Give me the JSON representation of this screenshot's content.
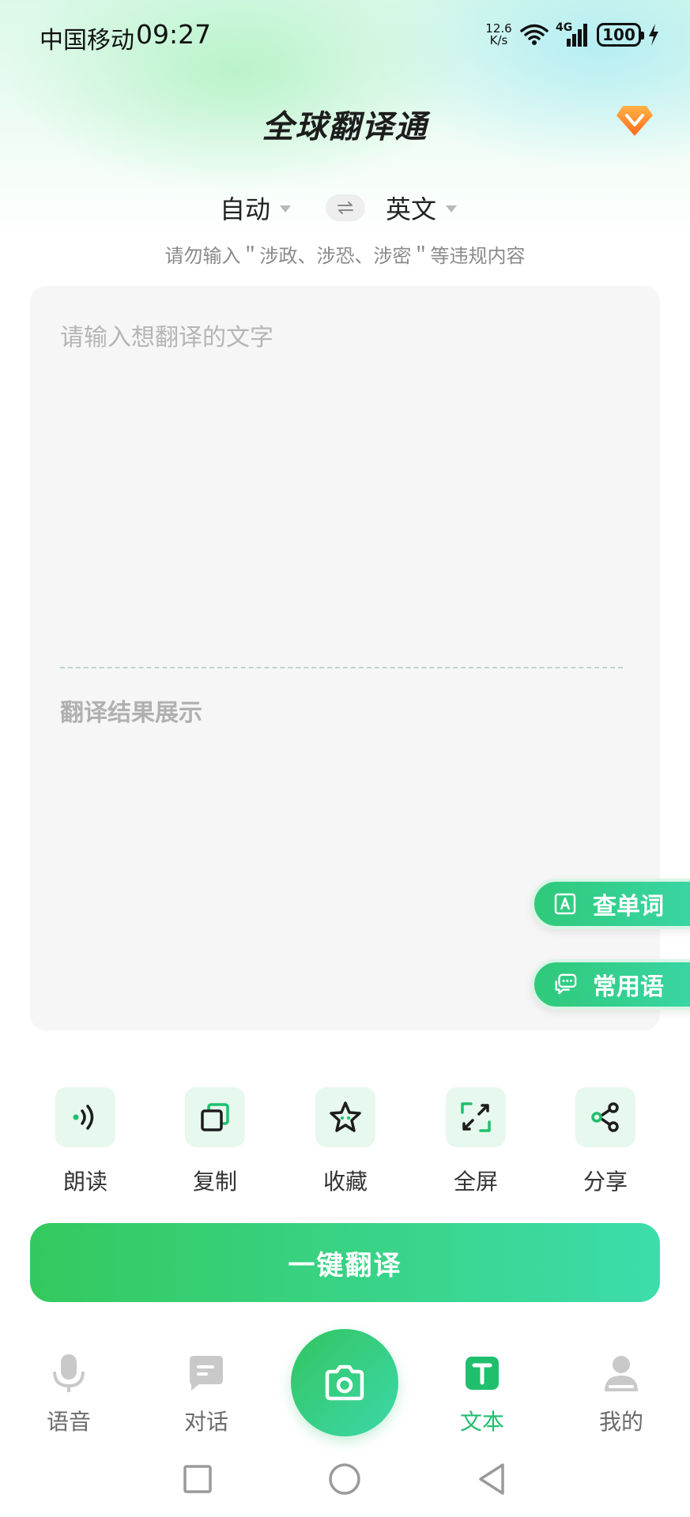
{
  "status_bar": {
    "carrier": "中国移动",
    "time": "09:27",
    "net_speed_value": "12.6",
    "net_speed_unit": "K/s",
    "network_type": "4G",
    "battery": "100"
  },
  "header": {
    "title": "全球翻译通",
    "vip_icon": "vip-diamond-icon"
  },
  "languages": {
    "source": "自动",
    "target": "英文",
    "swap_icon": "swap-arrows-icon"
  },
  "notice": "请勿输入＂涉政、涉恐、涉密＂等违规内容",
  "editor": {
    "input_placeholder": "请输入想翻译的文字",
    "result_placeholder": "翻译结果展示"
  },
  "floating_buttons": {
    "lookup_word": "查单词",
    "common_phrases": "常用语"
  },
  "actions": [
    {
      "label": "朗读",
      "icon": "speaker-icon"
    },
    {
      "label": "复制",
      "icon": "copy-icon"
    },
    {
      "label": "收藏",
      "icon": "star-icon"
    },
    {
      "label": "全屏",
      "icon": "fullscreen-icon"
    },
    {
      "label": "分享",
      "icon": "share-icon"
    }
  ],
  "translate_button": "一键翻译",
  "bottom_nav": {
    "voice": "语音",
    "dialog": "对话",
    "camera_icon": "camera-icon",
    "text": "文本",
    "mine": "我的",
    "active": "文本"
  },
  "colors": {
    "accent": "#2fc97a",
    "accent_end": "#3ddcab",
    "card_bg": "#f6f6f6"
  }
}
